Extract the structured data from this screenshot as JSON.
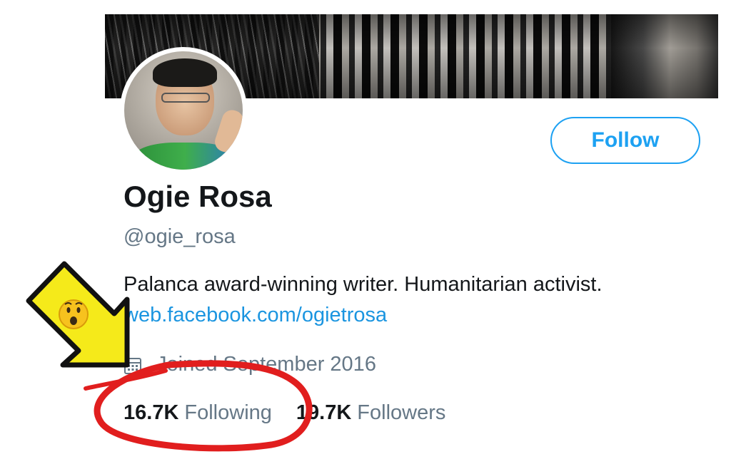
{
  "profile": {
    "name": "Ogie Rosa",
    "handle": "@ogie_rosa",
    "bio": "Palanca award-winning writer. Humanitarian activist.",
    "link": "web.facebook.com/ogietrosa",
    "joined": "Joined September 2016",
    "follow_label": "Follow"
  },
  "stats": {
    "following_count": "16.7K",
    "following_label": "Following",
    "followers_count": "19.7K",
    "followers_label": "Followers"
  },
  "annotation": {
    "emoji": "😮",
    "arrow_color": "#f5ea1a",
    "circle_color": "#e11e1e"
  },
  "colors": {
    "accent": "#1da1f2",
    "link": "#1b95e0",
    "muted": "#657786",
    "text": "#14171a"
  }
}
